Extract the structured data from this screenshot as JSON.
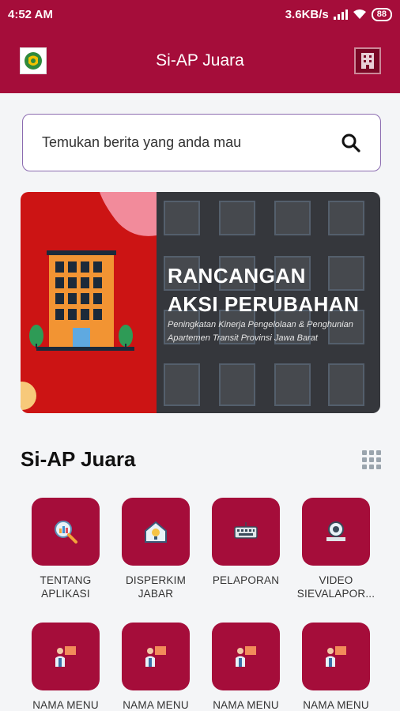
{
  "status_bar": {
    "time": "4:52 AM",
    "network_speed": "3.6KB/s",
    "battery": "88"
  },
  "app_bar": {
    "title": "Si-AP Juara"
  },
  "search": {
    "placeholder": "Temukan berita yang anda mau"
  },
  "banner": {
    "title_line1": "RANCANGAN",
    "title_line2": "AKSI PERUBAHAN",
    "subtitle": "Peningkatan Kinerja Pengelolaan & Penghunian Apartemen Transit Provinsi Jawa Barat"
  },
  "section": {
    "title": "Si-AP Juara"
  },
  "menu": [
    {
      "label": "TENTANG APLIKASI",
      "icon": "search-chart-icon"
    },
    {
      "label": "DISPERKIM JABAR",
      "icon": "house-idea-icon"
    },
    {
      "label": "PELAPORAN",
      "icon": "keyboard-icon"
    },
    {
      "label": "VIDEO SIEVALAPOR...",
      "icon": "video-camera-icon"
    },
    {
      "label": "NAMA MENU",
      "icon": "presenter-icon"
    },
    {
      "label": "NAMA MENU",
      "icon": "presenter-icon"
    },
    {
      "label": "NAMA MENU",
      "icon": "presenter-icon"
    },
    {
      "label": "NAMA MENU",
      "icon": "presenter-icon"
    }
  ],
  "colors": {
    "primary": "#a50d3a",
    "banner_red": "#cc1414",
    "search_border": "#8b6bb0"
  }
}
